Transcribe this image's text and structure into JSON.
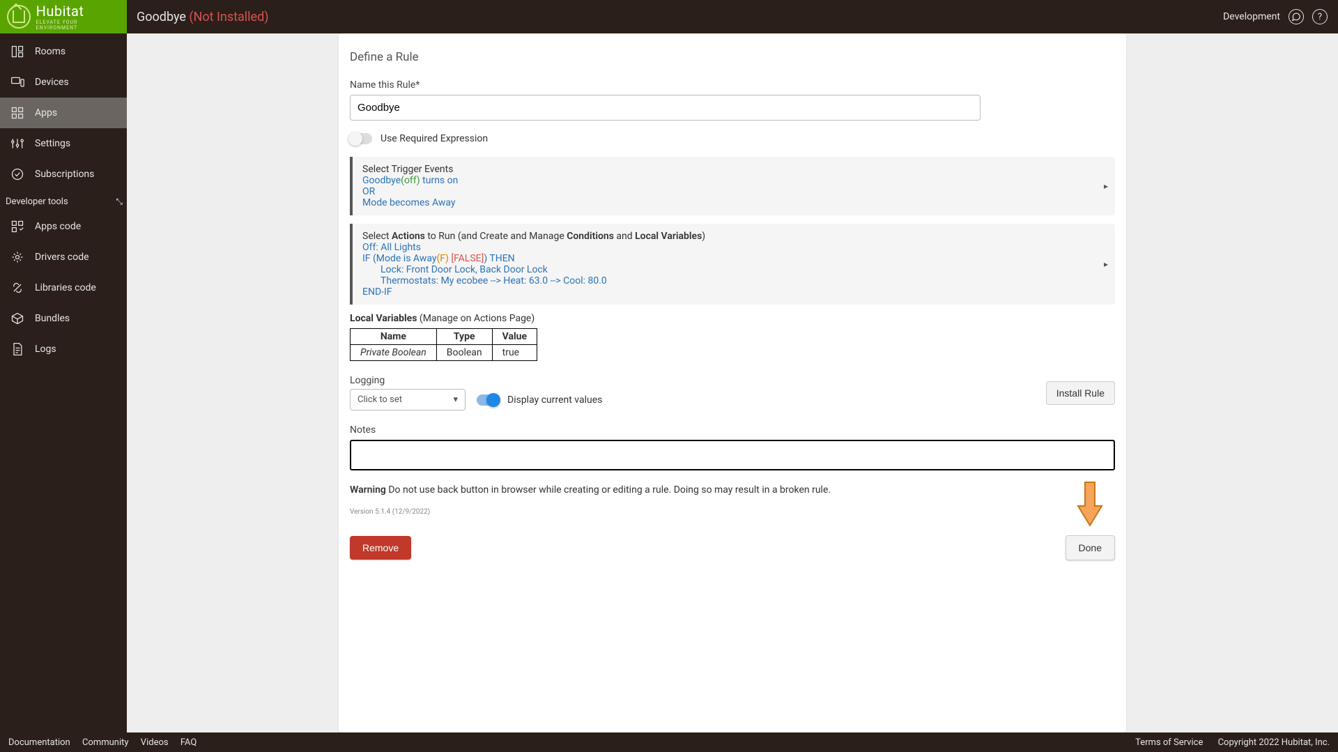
{
  "header": {
    "logo_big": "Hubitat",
    "logo_small": "ELEVATE YOUR ENVIRONMENT",
    "page_title": "Goodbye",
    "install_status": "(Not Installed)",
    "dev_label": "Development"
  },
  "sidebar": {
    "items": [
      {
        "label": "Rooms"
      },
      {
        "label": "Devices"
      },
      {
        "label": "Apps"
      },
      {
        "label": "Settings"
      },
      {
        "label": "Subscriptions"
      }
    ],
    "dev_header": "Developer tools",
    "dev_items": [
      {
        "label": "Apps code"
      },
      {
        "label": "Drivers code"
      },
      {
        "label": "Libraries code"
      },
      {
        "label": "Bundles"
      },
      {
        "label": "Logs"
      }
    ]
  },
  "main": {
    "section_title": "Define a Rule",
    "name_label": "Name this Rule*",
    "name_value": "Goodbye",
    "required_expr_label": "Use Required Expression",
    "triggers": {
      "head": "Select Trigger Events",
      "line1_a": "Goodbye",
      "line1_b": "(off)",
      "line1_c": " turns on",
      "or": "OR",
      "line2": "Mode becomes Away"
    },
    "actions": {
      "head_pre": "Select ",
      "head_b1": "Actions",
      "head_mid1": " to Run (and Create and Manage ",
      "head_b2": "Conditions",
      "head_mid2": " and ",
      "head_b3": "Local Variables",
      "head_end": ")",
      "l1": "Off: All Lights",
      "l2a": "IF (Mode is Away",
      "l2b": "(F)",
      "l2c": " [FALSE]",
      "l2d": ")",
      "l2e": " THEN",
      "l3": "Lock: Front Door Lock, Back Door Lock",
      "l4": "Thermostats: My ecobee --> Heat: 63.0 --> Cool: 80.0",
      "l5": "END-IF"
    },
    "localvars": {
      "title_b": "Local Variables",
      "title_rest": " (Manage on Actions Page)",
      "headers": [
        "Name",
        "Type",
        "Value"
      ],
      "row": [
        "Private Boolean",
        "Boolean",
        "true"
      ]
    },
    "logging": {
      "label": "Logging",
      "placeholder": "Click to set",
      "display_label": "Display current values",
      "install_btn": "Install Rule"
    },
    "notes_label": "Notes",
    "warning_b": "Warning",
    "warning_text": " Do not use back button in browser while creating or editing a rule. Doing so may result in a broken rule.",
    "version": "Version 5.1.4 (12/9/2022)",
    "remove_btn": "Remove",
    "done_btn": "Done"
  },
  "footer": {
    "left": [
      "Documentation",
      "Community",
      "Videos",
      "FAQ"
    ],
    "right_terms": "Terms of Service",
    "right_copy": "Copyright 2022 Hubitat, Inc."
  }
}
